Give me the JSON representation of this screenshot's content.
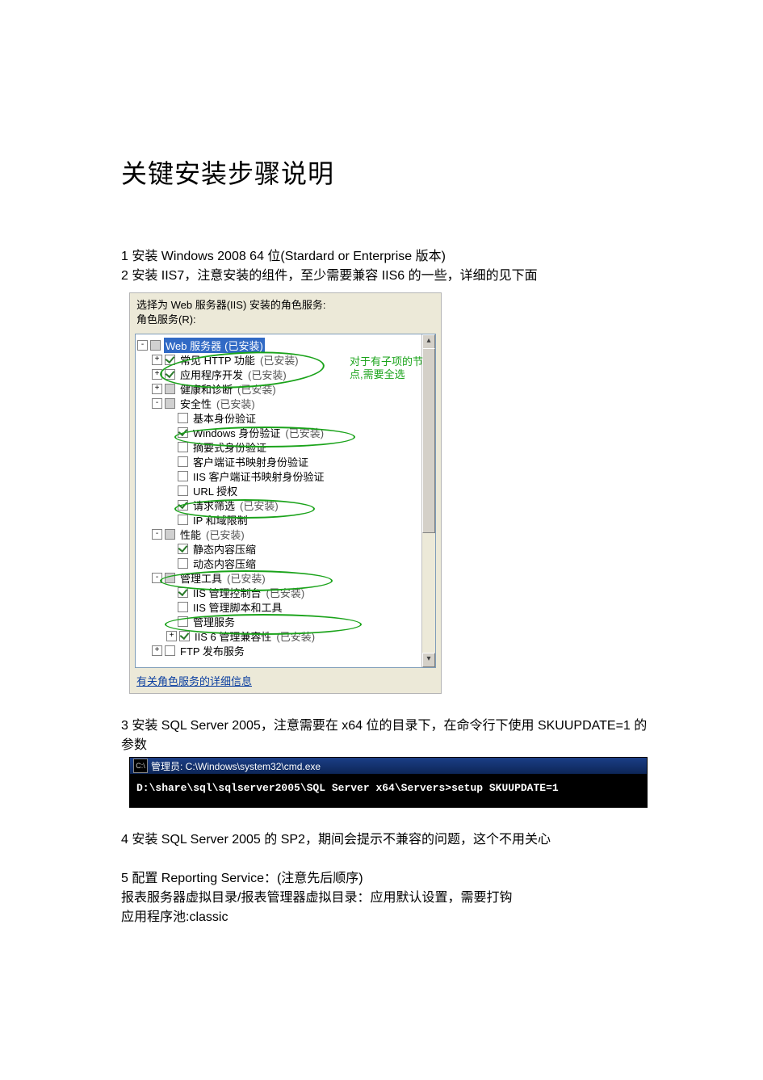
{
  "title": "关键安装步骤说明",
  "steps": {
    "s1": "1  安装 Windows 2008 64 位(Stardard or Enterprise 版本)",
    "s2": "2  安装 IIS7，注意安装的组件，至少需要兼容 IIS6 的一些，详细的见下面",
    "s3": "3  安装 SQL Server  2005，注意需要在 x64 位的目录下，在命令行下使用 SKUUPDATE=1 的参数",
    "s4": "4  安装 SQL Server 2005 的 SP2，期间会提示不兼容的问题，这个不用关心",
    "s5": "5  配置 Reporting Service：(注意先后顺序)",
    "s5a": "报表服务器虚拟目录/报表管理器虚拟目录：应用默认设置，需要打钩",
    "s5b": "应用程序池:classic"
  },
  "iis": {
    "header1": "选择为 Web 服务器(IIS) 安装的角色服务:",
    "header2": "角色服务(R):",
    "annotation": "对于有子项的节点,需要全选",
    "link": "有关角色服务的详细信息",
    "tree": [
      {
        "depth": 0,
        "exp": "-",
        "chk": "mixed",
        "text": "Web 服务器",
        "inst": "(已安装)",
        "sel": true
      },
      {
        "depth": 1,
        "exp": "+",
        "chk": "on",
        "text": "常见 HTTP 功能",
        "inst": "(已安装)"
      },
      {
        "depth": 1,
        "exp": "+",
        "chk": "on",
        "text": "应用程序开发",
        "inst": "(已安装)"
      },
      {
        "depth": 1,
        "exp": "+",
        "chk": "mixed",
        "text": "健康和诊断",
        "inst": "(已安装)"
      },
      {
        "depth": 1,
        "exp": "-",
        "chk": "mixed",
        "text": "安全性",
        "inst": "(已安装)"
      },
      {
        "depth": 2,
        "exp": " ",
        "chk": "off",
        "text": "基本身份验证"
      },
      {
        "depth": 2,
        "exp": " ",
        "chk": "on",
        "text": "Windows 身份验证",
        "inst": "(已安装)"
      },
      {
        "depth": 2,
        "exp": " ",
        "chk": "off",
        "text": "摘要式身份验证"
      },
      {
        "depth": 2,
        "exp": " ",
        "chk": "off",
        "text": "客户端证书映射身份验证"
      },
      {
        "depth": 2,
        "exp": " ",
        "chk": "off",
        "text": "IIS 客户端证书映射身份验证"
      },
      {
        "depth": 2,
        "exp": " ",
        "chk": "off",
        "text": "URL 授权"
      },
      {
        "depth": 2,
        "exp": " ",
        "chk": "on",
        "text": "请求筛选",
        "inst": "(已安装)"
      },
      {
        "depth": 2,
        "exp": " ",
        "chk": "off",
        "text": "IP 和域限制"
      },
      {
        "depth": 1,
        "exp": "-",
        "chk": "mixed",
        "text": "性能",
        "inst": "(已安装)"
      },
      {
        "depth": 2,
        "exp": " ",
        "chk": "on",
        "text": "静态内容压缩"
      },
      {
        "depth": 2,
        "exp": " ",
        "chk": "off",
        "text": "动态内容压缩"
      },
      {
        "depth": 1,
        "exp": "-",
        "chk": "mixed",
        "text": "管理工具",
        "inst": "(已安装)"
      },
      {
        "depth": 2,
        "exp": " ",
        "chk": "on",
        "text": "IIS 管理控制台",
        "inst": "(已安装)"
      },
      {
        "depth": 2,
        "exp": " ",
        "chk": "off",
        "text": "IIS 管理脚本和工具"
      },
      {
        "depth": 2,
        "exp": " ",
        "chk": "off",
        "text": "管理服务"
      },
      {
        "depth": 2,
        "exp": "+",
        "chk": "on",
        "text": "IIS 6 管理兼容性",
        "inst": "(已安装)"
      },
      {
        "depth": 1,
        "exp": "+",
        "chk": "off",
        "text": "FTP 发布服务"
      }
    ]
  },
  "cmd": {
    "title": "管理员: C:\\Windows\\system32\\cmd.exe",
    "line": "D:\\share\\sql\\sqlserver2005\\SQL Server x64\\Servers>setup SKUUPDATE=1"
  }
}
